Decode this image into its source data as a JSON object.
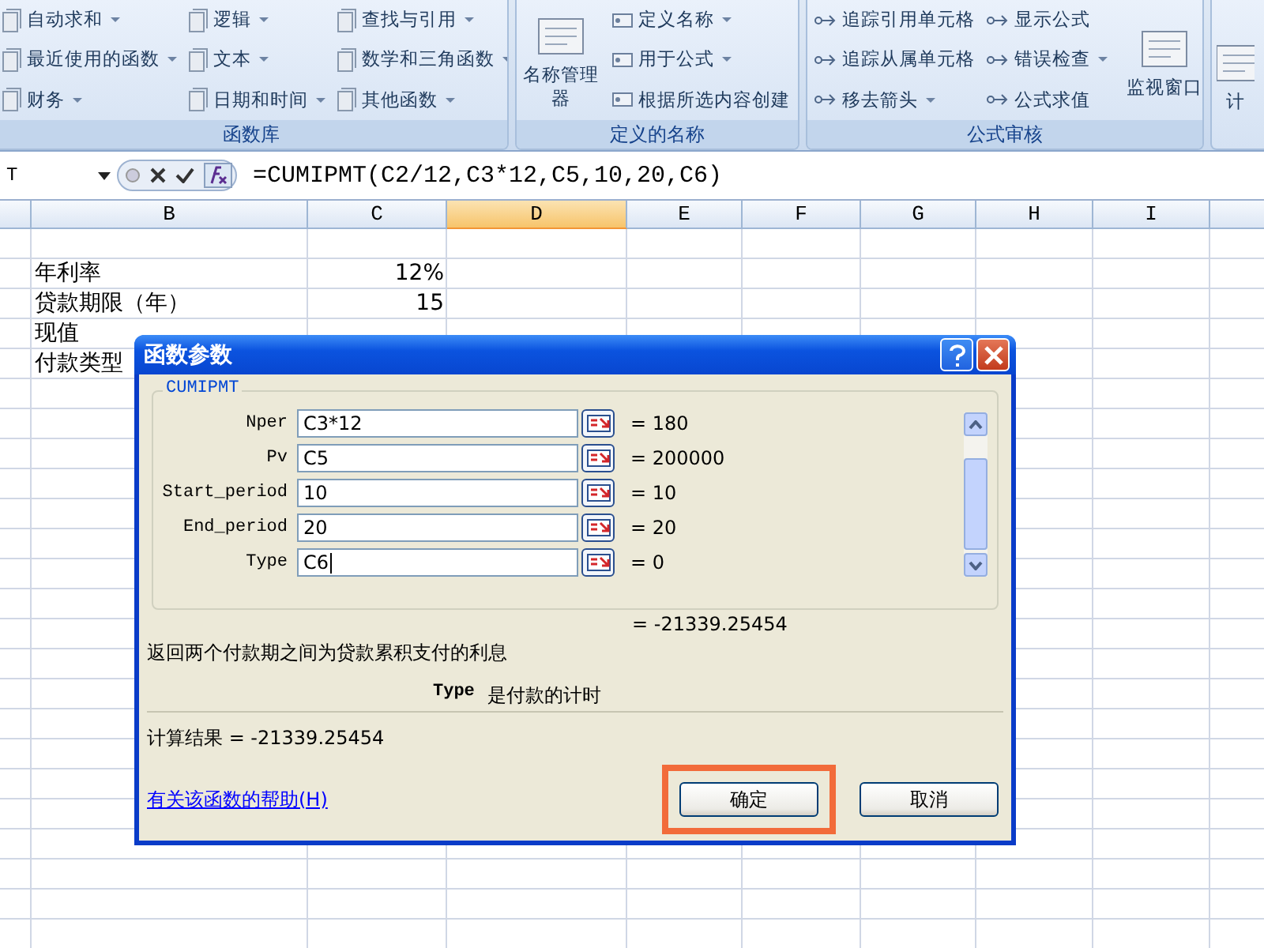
{
  "ribbon": {
    "groups": [
      {
        "label": "函数库",
        "columns": [
          [
            {
              "label": "自动求和",
              "dropdown": true
            },
            {
              "label": "最近使用的函数",
              "dropdown": true
            },
            {
              "label": "财务",
              "dropdown": true
            }
          ],
          [
            {
              "label": "逻辑",
              "dropdown": true
            },
            {
              "label": "文本",
              "dropdown": true
            },
            {
              "label": "日期和时间",
              "dropdown": true
            }
          ],
          [
            {
              "label": "查找与引用",
              "dropdown": true
            },
            {
              "label": "数学和三角函数",
              "dropdown": true
            },
            {
              "label": "其他函数",
              "dropdown": true
            }
          ]
        ]
      },
      {
        "label": "定义的名称",
        "big": "名称管理器",
        "columns": [
          [
            {
              "label": "定义名称",
              "dropdown": true
            },
            {
              "label": "用于公式",
              "dropdown": true
            },
            {
              "label": "根据所选内容创建",
              "dropdown": false
            }
          ]
        ]
      },
      {
        "label": "公式审核",
        "columns": [
          [
            {
              "label": "追踪引用单元格",
              "dropdown": false
            },
            {
              "label": "追踪从属单元格",
              "dropdown": false
            },
            {
              "label": "移去箭头",
              "dropdown": true
            }
          ],
          [
            {
              "label": "显示公式",
              "dropdown": false
            },
            {
              "label": "错误检查",
              "dropdown": true
            },
            {
              "label": "公式求值",
              "dropdown": false
            }
          ]
        ],
        "big_after": "监视窗口"
      },
      {
        "big": "计"
      }
    ]
  },
  "formula_bar": {
    "name_box": "T",
    "formula": "=CUMIPMT(C2/12,C3*12,C5,10,20,C6)"
  },
  "sheet": {
    "columns": [
      {
        "selected": false
      },
      {
        "label": "B",
        "selected": false
      },
      {
        "label": "C",
        "selected": false
      },
      {
        "label": "D",
        "selected": true
      },
      {
        "label": "E",
        "selected": false
      },
      {
        "label": "F",
        "selected": false
      },
      {
        "label": "G",
        "selected": false
      },
      {
        "label": "H",
        "selected": false
      },
      {
        "label": "I",
        "selected": false
      },
      {
        "selected": false
      }
    ],
    "rows": [
      [
        "",
        ""
      ],
      [
        "年利率",
        "12%"
      ],
      [
        "贷款期限（年）",
        "15"
      ],
      [
        "现值",
        ""
      ],
      [
        "付款类型",
        ""
      ]
    ]
  },
  "dialog": {
    "title": "函数参数",
    "function": "CUMIPMT",
    "args": [
      {
        "name": "Nper",
        "value": "C3*12",
        "result": "= 180",
        "focused": false
      },
      {
        "name": "Pv",
        "value": "C5",
        "result": "= 200000",
        "focused": false
      },
      {
        "name": "Start_period",
        "value": "10",
        "result": "= 10",
        "focused": false
      },
      {
        "name": "End_period",
        "value": "20",
        "result": "= 20",
        "focused": false
      },
      {
        "name": "Type",
        "value": "C6",
        "result": "= 0",
        "focused": true
      }
    ],
    "total": "= -21339.25454",
    "description": "返回两个付款期之间为贷款累积支付的利息",
    "arg_name": "Type",
    "arg_help": "是付款的计时",
    "result_line": "计算结果 = -21339.25454",
    "help_link": "有关该函数的帮助(H)",
    "buttons": [
      {
        "label": "确定",
        "highlighted": true
      },
      {
        "label": "取消",
        "highlighted": false
      }
    ]
  }
}
